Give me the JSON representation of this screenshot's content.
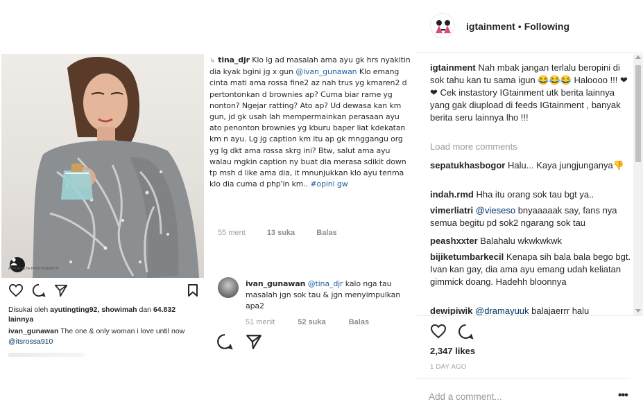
{
  "post": {
    "left_screenshot": {
      "likes_prefix": "Disukai oleh",
      "liked_by": "ayutingting92, showimah",
      "likes_joiner": "dan",
      "likes_count": "64.832",
      "likes_suffix": "lainnya",
      "caption_user": "ivan_gunawan",
      "caption_text": "The one & only  woman i love until now",
      "caption_mention": "@itsrossa910",
      "photo_watermark": "ADIKADIETA PHOTOGRAPHY"
    },
    "mid_screenshot": {
      "comment1": {
        "user": "tina_djr",
        "text_before": "Klo lg ad masalah ama ayu gk hrs nyakitin dia kyak bgini jg x gun",
        "mention": "@ivan_gunawan",
        "text_after": "Klo emang cinta mati ama rossa fine2 az nah trus yg kmaren2 d pertontonkan d brownies ap? Cuma biar rame yg nonton? Ngejar ratting? Ato ap? Ud dewasa kan km gun, jd gk usah lah mempermainkan perasaan ayu ato penonton brownies yg kburu baper liat kdekatan km n ayu. Lg jg caption km itu ap gk mnggangu org yg lg dkt ama rossa skrg ini? Btw, salut ama ayu walau mgkin caption ny buat dia merasa sdikit down tp msh d like ama dia, it mnunjukkan klo ayu terima klo dia cuma d php'in km..",
        "hashtag": "#opini gw",
        "time": "55 ment",
        "likes": "13 suka",
        "reply": "Balas"
      },
      "comment2": {
        "user": "ivan_gunawan",
        "mention": "@tina_djr",
        "text": "kalo nga tau masalah jgn sok tau & jgn menyimpulkan apa2",
        "time": "51 menit",
        "likes": "52 suka",
        "reply": "Balas"
      }
    }
  },
  "panel": {
    "username": "igtainment",
    "separator": "•",
    "follow_status": "Following",
    "load_more": "Load more comments",
    "caption": {
      "user": "igtainment",
      "text": "Nah mbak jangan terlalu beropini di sok tahu kan tu sama igun 😂😂😂 Haloooo !!! ❤❤ Cek instastory IGtainment utk berita lainnya yang gak diupload di feeds IGtainment , banyak berita seru lainnya lho !!!"
    },
    "comments": [
      {
        "user": "sepatukhasbogor",
        "text": "Halu... Kaya jungjunganya👎"
      },
      {
        "user": "indah.rmd",
        "text": "Hha itu orang sok tau bgt ya.."
      },
      {
        "user": "vimerliatri",
        "mention": "@vieseso",
        "text": "bnyaaaaak say, fans nya semua begitu pd sok2 ngarang sok tau"
      },
      {
        "user": "peashxxter",
        "text": "Balahalu wkwkwkwk"
      },
      {
        "user": "bijiketumbarkecil",
        "text": "Kenapa sih bala bala bego bgt. Ivan kan gay, dia ama ayu emang udah keliatan gimmick doang. Hadehh bloonnya"
      },
      {
        "user": "dewipiwik",
        "mention": "@dramayuuk",
        "text": "balajaerrr halu"
      }
    ],
    "likes": "2,347 likes",
    "time_ago": "1 DAY AGO",
    "add_comment_placeholder": "Add a comment...",
    "more_options": "•••"
  },
  "colors": {
    "text": "#262626",
    "muted": "#999999",
    "mention": "#003569",
    "border": "#efefef"
  },
  "icons": [
    "heart-icon",
    "comment-icon",
    "share-icon",
    "bookmark-icon",
    "user-tag-icon",
    "more-options-icon"
  ]
}
